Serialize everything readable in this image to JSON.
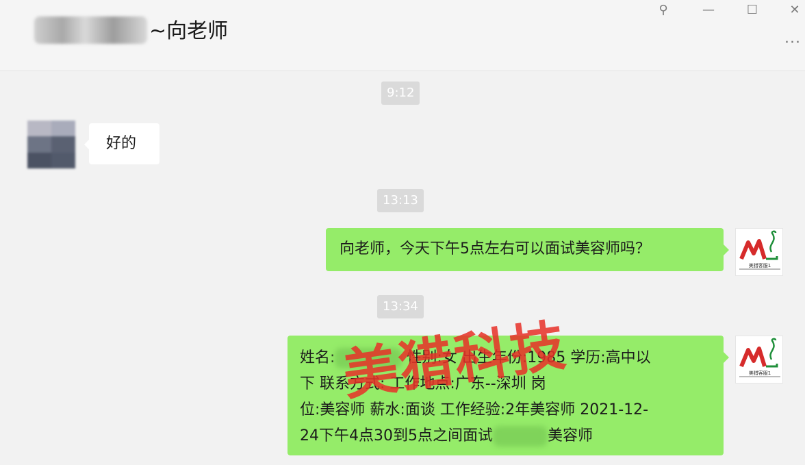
{
  "header": {
    "title_suffix": "~向老师",
    "more_label": "···"
  },
  "window_controls": {
    "pin": "⚲",
    "minimize": "—",
    "maximize": "☐",
    "close": "✕"
  },
  "messages": [
    {
      "type": "time",
      "text": "9:12"
    },
    {
      "type": "incoming",
      "text": "好的"
    },
    {
      "type": "time",
      "text": "13:13"
    },
    {
      "type": "outgoing",
      "text": "向老师，今天下午5点左右可以面试美容师吗？"
    },
    {
      "type": "time",
      "text": "13:34"
    },
    {
      "type": "outgoing",
      "lines": [
        {
          "before": "姓名:",
          "after": " 性别:女 出生年份:1985 学历:高中以"
        },
        {
          "text": "下 联系方式:  工作地点:广东--深圳 岗"
        },
        {
          "text": "位:美容师 薪水:面谈 工作经验:2年美容师 2021-12-"
        },
        {
          "before": "24下午4点30到5点之间面试",
          "after": "美容师"
        }
      ]
    }
  ],
  "brand_avatar": {
    "logo_text": "ML",
    "caption": "美猎客服1",
    "colors": {
      "m": "#d62b2b",
      "l": "#1f8f3a"
    }
  },
  "watermark": {
    "text": "美猎科技",
    "color": "#e73028"
  },
  "colors": {
    "outgoing_bubble": "#95ec69",
    "incoming_bubble": "#ffffff",
    "background": "#f2f2f2",
    "time_badge": "#dadada"
  }
}
